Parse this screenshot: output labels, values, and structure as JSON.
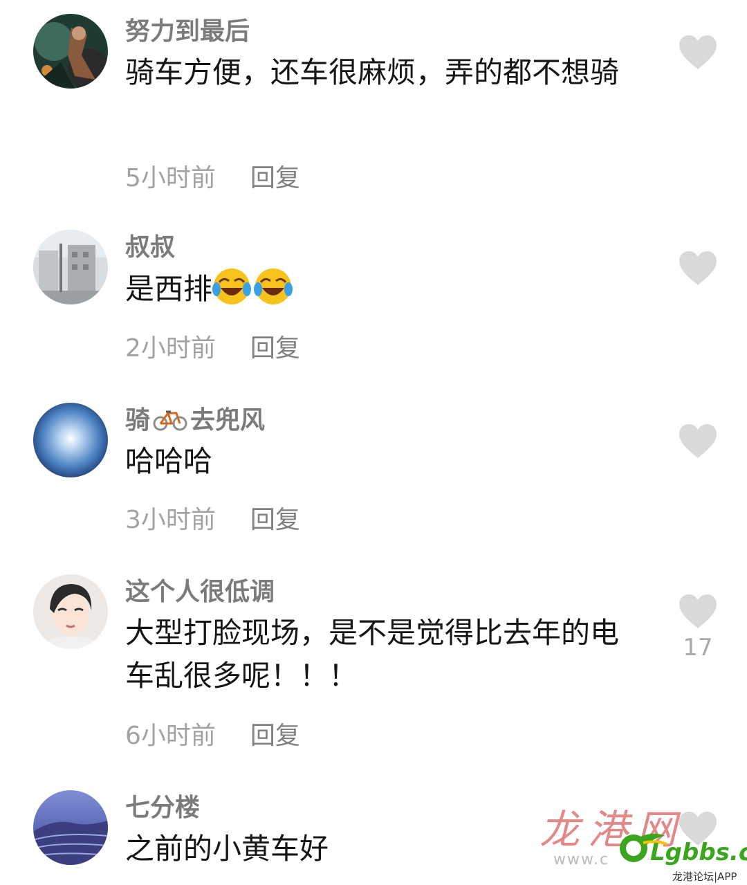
{
  "comments": [
    {
      "username": "努力到最后",
      "text": "骑车方便，还车很麻烦，弄的都不想骑",
      "time": "5小时前",
      "reply": "回复",
      "likes": ""
    },
    {
      "username": "叔叔",
      "text": "是西排",
      "emojis": [
        "laugh-cry-emoji",
        "laugh-cry-emoji"
      ],
      "time": "2小时前",
      "reply": "回复",
      "likes": ""
    },
    {
      "username_prefix": "骑",
      "username_suffix": "去兜风",
      "username_icon": "bicycle-emoji",
      "text": "哈哈哈",
      "time": "3小时前",
      "reply": "回复",
      "likes": ""
    },
    {
      "username": "这个人很低调",
      "text": "大型打脸现场，是不是觉得比去年的电车乱很多呢！！！",
      "time": "6小时前",
      "reply": "回复",
      "likes": "17"
    },
    {
      "username": "七分楼",
      "text": "之前的小黄车好",
      "time": "",
      "reply": "",
      "likes": ""
    }
  ],
  "watermark": {
    "site_name": "龙港网",
    "site_url": "www.c",
    "brand": "Lgbbs.cn",
    "sub": "龙港论坛|APP"
  },
  "colors": {
    "username": "#7b7b7b",
    "text": "#161616",
    "meta": "#a2a2a2",
    "like_icon": "#d9d9d9",
    "brand": "#3aa61f"
  }
}
